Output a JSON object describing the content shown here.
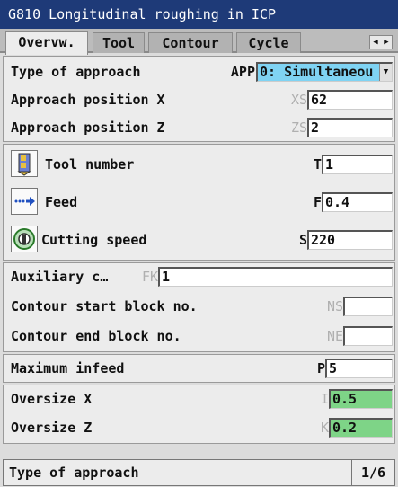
{
  "window": {
    "title": "G810 Longitudinal roughing in ICP"
  },
  "tabs": [
    {
      "label": "Overvw."
    },
    {
      "label": "Tool"
    },
    {
      "label": "Contour"
    },
    {
      "label": "Cycle"
    }
  ],
  "approach": {
    "type_label": "Type of approach",
    "type_abbr": "APP",
    "type_value": "0: Simultaneou",
    "pos_x_label": "Approach position X",
    "pos_x_abbr": "XS",
    "pos_x_value": "62",
    "pos_z_label": "Approach position Z",
    "pos_z_abbr": "ZS",
    "pos_z_value": "2"
  },
  "tooling": {
    "tool_label": "Tool number",
    "tool_abbr": "T",
    "tool_value": "1",
    "feed_label": "Feed",
    "feed_abbr": "F",
    "feed_value": "0.4",
    "speed_label": "Cutting speed",
    "speed_abbr": "S",
    "speed_value": "220"
  },
  "contour": {
    "aux_label": "Auxiliary c…",
    "aux_abbr": "FK",
    "aux_value": "1",
    "start_label": "Contour start block no.",
    "start_abbr": "NS",
    "start_value": "",
    "end_label": "Contour end block no.",
    "end_abbr": "NE",
    "end_value": ""
  },
  "infeed": {
    "label": "Maximum infeed",
    "abbr": "P",
    "value": "5"
  },
  "oversize": {
    "x_label": "Oversize X",
    "x_abbr": "I",
    "x_value": "0.5",
    "z_label": "Oversize Z",
    "z_abbr": "K",
    "z_value": "0.2"
  },
  "status": {
    "text": "Type of approach",
    "page": "1/6"
  },
  "icons": {
    "tool": "tool-icon",
    "feed": "feed-icon",
    "speed": "spindle-icon"
  },
  "colors": {
    "title_bg": "#1e3a78",
    "selected_field": "#7fd3f3",
    "oversize_field": "#7ed487"
  }
}
